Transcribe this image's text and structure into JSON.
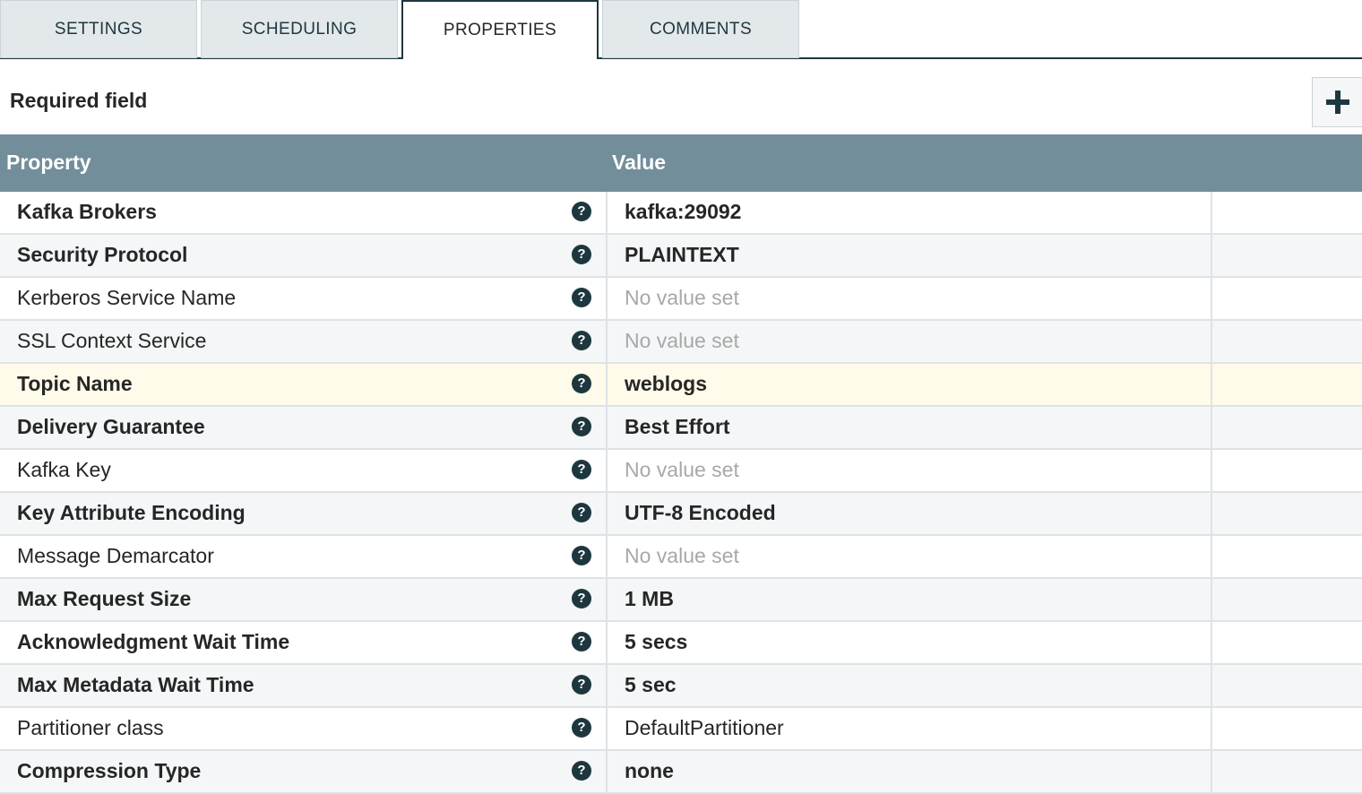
{
  "tabs": [
    {
      "label": "SETTINGS",
      "active": false
    },
    {
      "label": "SCHEDULING",
      "active": false
    },
    {
      "label": "PROPERTIES",
      "active": true
    },
    {
      "label": "COMMENTS",
      "active": false
    }
  ],
  "required_label": "Required field",
  "add_icon": "plus-icon",
  "help_icon": "question-circle-icon",
  "table": {
    "headers": {
      "property": "Property",
      "value": "Value"
    },
    "rows": [
      {
        "name": "Kafka Brokers",
        "value": "kafka:29092",
        "required": true,
        "set": true
      },
      {
        "name": "Security Protocol",
        "value": "PLAINTEXT",
        "required": true,
        "set": true
      },
      {
        "name": "Kerberos Service Name",
        "value": "No value set",
        "required": false,
        "set": false
      },
      {
        "name": "SSL Context Service",
        "value": "No value set",
        "required": false,
        "set": false
      },
      {
        "name": "Topic Name",
        "value": "weblogs",
        "required": true,
        "set": true,
        "selected": true
      },
      {
        "name": "Delivery Guarantee",
        "value": "Best Effort",
        "required": true,
        "set": true
      },
      {
        "name": "Kafka Key",
        "value": "No value set",
        "required": false,
        "set": false
      },
      {
        "name": "Key Attribute Encoding",
        "value": "UTF-8 Encoded",
        "required": true,
        "set": true
      },
      {
        "name": "Message Demarcator",
        "value": "No value set",
        "required": false,
        "set": false
      },
      {
        "name": "Max Request Size",
        "value": "1 MB",
        "required": true,
        "set": true
      },
      {
        "name": "Acknowledgment Wait Time",
        "value": "5 secs",
        "required": true,
        "set": true
      },
      {
        "name": "Max Metadata Wait Time",
        "value": "5 sec",
        "required": true,
        "set": true
      },
      {
        "name": "Partitioner class",
        "value": "DefaultPartitioner",
        "required": false,
        "set": true
      },
      {
        "name": "Compression Type",
        "value": "none",
        "required": true,
        "set": true
      }
    ]
  },
  "colors": {
    "header_bg": "#728e9b",
    "accent": "#1e373f",
    "selected_row": "#fffbea",
    "unset_value": "#a8a8a8"
  }
}
